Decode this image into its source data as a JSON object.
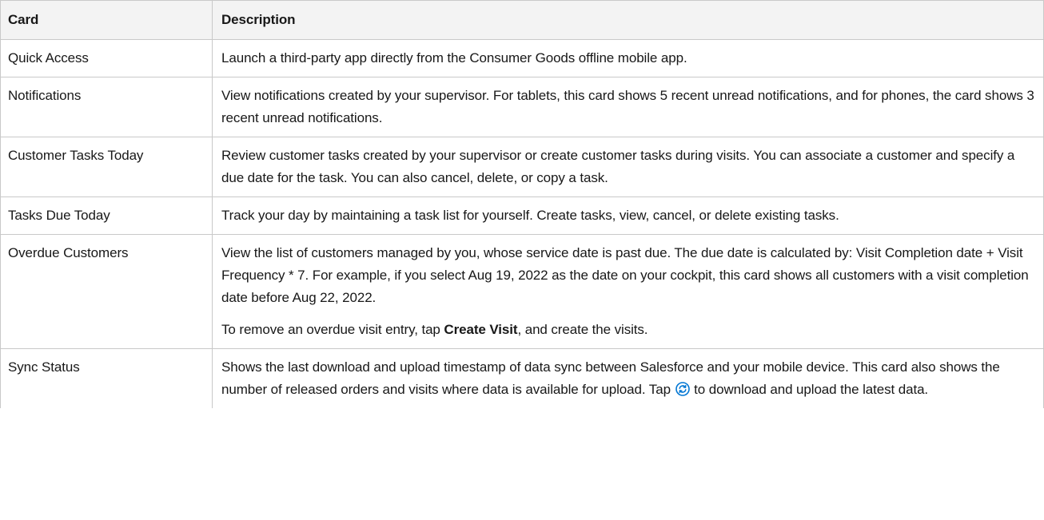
{
  "table": {
    "headers": [
      "Card",
      "Description"
    ],
    "rows": [
      {
        "card": "Quick Access",
        "description": "Launch a third-party app directly from the Consumer Goods offline mobile app."
      },
      {
        "card": "Notifications",
        "description": "View notifications created by your supervisor. For tablets, this card shows 5 recent unread notifications, and for phones, the card shows 3 recent unread notifications."
      },
      {
        "card": "Customer Tasks Today",
        "description": "Review customer tasks created by your supervisor or create customer tasks during visits. You can associate a customer and specify a due date for the task. You can also cancel, delete, or copy a task."
      },
      {
        "card": "Tasks Due Today",
        "description": "Track your day by maintaining a task list for yourself. Create tasks, view, cancel, or delete existing tasks."
      },
      {
        "card": "Overdue Customers",
        "description": "View the list of customers managed by you, whose service date is past due. The due date is calculated by: Visit Completion date + Visit Frequency * 7. For example, if you select Aug 19, 2022 as the date on your cockpit, this card shows all customers with a visit completion date before Aug 22, 2022.",
        "note_prefix": "To remove an overdue visit entry, tap ",
        "note_bold": "Create Visit",
        "note_suffix": ", and create the visits."
      },
      {
        "card": "Sync Status",
        "description": "Shows the last download and upload timestamp of data sync between Salesforce and your mobile device. This card also shows the number of released orders and visits where data is available for upload. Tap ",
        "icon": "sync-icon",
        "description_suffix": " to download and upload the latest data."
      }
    ]
  },
  "colors": {
    "border": "#c9c9c9",
    "header_bg": "#f3f3f3",
    "text": "#181818",
    "icon_blue": "#0176d3"
  }
}
